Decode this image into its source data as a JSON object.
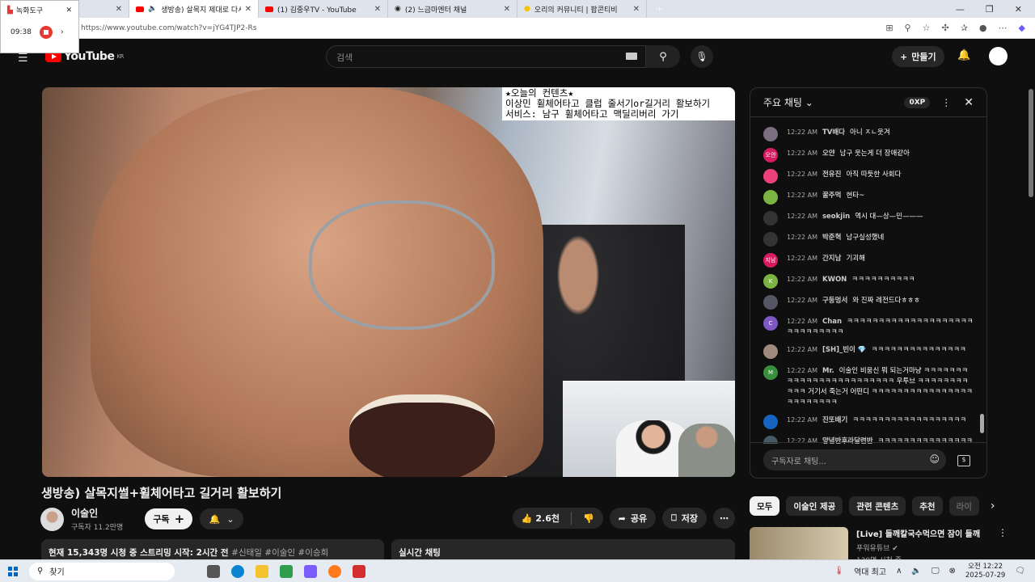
{
  "browser": {
    "tabs": [
      {
        "title": "",
        "active": false
      },
      {
        "title": "생방송) 살목지 제대로 다시",
        "active": true,
        "icon": "youtube-icon",
        "audio": true
      },
      {
        "title": "(1) 김중우TV - YouTube",
        "active": false,
        "icon": "youtube-icon"
      },
      {
        "title": "(2) 느금마엔터 채널",
        "active": false
      },
      {
        "title": "오리의 커뮤니티 | 팝콘티비",
        "active": false
      }
    ],
    "url": "https://www.youtube.com/watch?v=jYG4TJP2-Rs"
  },
  "recorder": {
    "title": "녹화도구",
    "time": "09:38"
  },
  "youtube": {
    "logo": "YouTube",
    "region": "KR",
    "search_placeholder": "검색",
    "create_label": "만들기",
    "video": {
      "overlay_lines": [
        "★오늘의 컨텐츠★",
        "이상민 휠체어타고 클럽 줄서기or길거리 활보하기",
        "서비스: 남구 휠체어타고 맥딜리버리 가기"
      ],
      "title": "생방송) 살목지썰+휠체어타고 길거리 활보하기",
      "channel": "이술인",
      "subscribers": "구독자 11.2만명",
      "subscribe_label": "구독",
      "likes": "2.6천",
      "share_label": "공유",
      "save_label": "저장",
      "description": "현재 15,343명 시청 중  스트리밍 시작: 2시간 전",
      "tags": "#신태일 #이술인 #이승희",
      "live_chat_label": "실시간 채팅"
    },
    "chat": {
      "header": "주요 채팅",
      "xp": "0XP",
      "input_placeholder": "구독자로 채팅...",
      "messages": [
        {
          "time": "12:22 AM",
          "author": "TV배다",
          "text": "아니 ㅈㄴ웃겨",
          "avatar": "",
          "color": "#7a6e80"
        },
        {
          "time": "12:22 AM",
          "author": "오얀",
          "text": "남구 웃는게 더 장애같아",
          "avatar": "오얀",
          "color": "#d81b60"
        },
        {
          "time": "12:22 AM",
          "author": "전유진",
          "text": "아직 따듯한 사회다",
          "avatar": "",
          "color": "#ec407a"
        },
        {
          "time": "12:22 AM",
          "author": "꿀주먹",
          "text": "현타~",
          "avatar": "",
          "color": "#7cb342"
        },
        {
          "time": "12:22 AM",
          "author": "seokjin",
          "text": "역시 대—상—민———",
          "avatar": "",
          "color": "#333"
        },
        {
          "time": "12:22 AM",
          "author": "박준혁",
          "text": "남구실성했네",
          "avatar": "",
          "color": "#333"
        },
        {
          "time": "12:22 AM",
          "author": "간지남",
          "text": "기괴해",
          "avatar": "지남",
          "color": "#d81b60"
        },
        {
          "time": "12:22 AM",
          "author": "KWON",
          "text": "ㅋㅋㅋㅋㅋㅋㅋㅋㅋㅋ",
          "avatar": "K",
          "color": "#7cb342"
        },
        {
          "time": "12:22 AM",
          "author": "구둥멍서",
          "text": "와 진짜 레전드다ㅎㅎㅎ",
          "avatar": "",
          "color": "#556"
        },
        {
          "time": "12:22 AM",
          "author": "Chan",
          "text": "ㅋㅋㅋㅋㅋㅋㅋㅋㅋㅋㅋㅋㅋㅋㅋㅋㅋㅋㅋㅋㅋㅋㅋㅋㅋㅋㅋㅋㅋ",
          "avatar": "C",
          "color": "#7e57c2"
        },
        {
          "time": "12:22 AM",
          "author": "[SH]_빈이 💎",
          "text": "ㅋㅋㅋㅋㅋㅋㅋㅋㅋㅋㅋㅋㅋㅋㅋ",
          "avatar": "",
          "color": "#a08a80"
        },
        {
          "time": "12:22 AM",
          "author": "Mr.",
          "text": "이술인 비웅신 뭐 되는거마냥 ㅋㅋㅋㅋㅋㅋㅋㅋㅋㅋㅋㅋㅋㅋㅋㅋㅋㅋㅋㅋㅋㅋㅋㅋ 우투브 ㅋㅋㅋㅋㅋㅋㅋㅋㅋㅋㅋ 거기서 죽는거 어떤디 ㅋㅋㅋㅋㅋㅋㅋㅋㅋㅋㅋㅋㅋㅋㅋㅋㅋㅋㅋㅋㅋㅋㅋㅋ",
          "avatar": "M",
          "color": "#388e3c"
        },
        {
          "time": "12:22 AM",
          "author": "진또배기",
          "text": "ㅋㅋㅋㅋㅋㅋㅋㅋㅋㅋㅋㅋㅋㅋㅋㅋㅋㅋ",
          "avatar": "",
          "color": "#1565c0"
        },
        {
          "time": "12:22 AM",
          "author": "양념반후라달련반",
          "text": "ㅋㅋㅋㅋㅋㅋㅋㅋㅋㅋㅋㅋㅋㅋㅋㅋㅋㅋㅋㅋㅋㅋㅋㅋㅋㅋㅋ",
          "avatar": "",
          "color": "#455a64"
        }
      ]
    },
    "chips": [
      "모두",
      "이술인 제공",
      "관련 콘텐츠",
      "추천",
      "라이"
    ],
    "recommended": {
      "title": "[Live] 들깨칼국수먹으면 잠이 들깨",
      "channel": "푸워유튜브",
      "views": "139명 시청 중"
    }
  },
  "taskbar": {
    "search": "찾기",
    "weather": "역대 최고",
    "time": "오전 12:22",
    "date": "2025-07-29"
  }
}
